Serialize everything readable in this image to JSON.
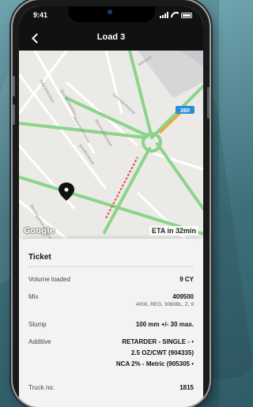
{
  "status_bar": {
    "time": "9:41"
  },
  "header": {
    "title": "Load 3"
  },
  "map": {
    "street_labels": [
      "Fabrikstrasse",
      "Quellenstrasse",
      "Motorenstrasse",
      "Heinrichstrasse",
      "Josefstrasse",
      "Limmatstrasse",
      "Sihlquai",
      "Rosengartenstrasse"
    ],
    "route_badge": "260",
    "google_label": "Google",
    "eta_text": "ETA in 32min",
    "colors": {
      "traffic_green": "#8bd48a",
      "traffic_red": "#d9534f",
      "traffic_orange": "#f0a13a",
      "badge": "#2a8fd6"
    }
  },
  "ticket": {
    "title": "Ticket",
    "rows": [
      {
        "label": "Volume loaded",
        "value": "9 CY"
      },
      {
        "label": "Mix",
        "value": "409500",
        "sub": "4000, REG, 3060BL, Z, 9"
      },
      {
        "label": "Slump",
        "value": "100 mm +/- 30 max."
      },
      {
        "label": "Additive",
        "value_lines": [
          "RETARDER - SINGLE - •",
          "2.5 OZ/CWT (904335)",
          "NCA 2% - Metric (905305 •"
        ]
      },
      {
        "label": "Truck no.",
        "value": "1815"
      }
    ]
  }
}
